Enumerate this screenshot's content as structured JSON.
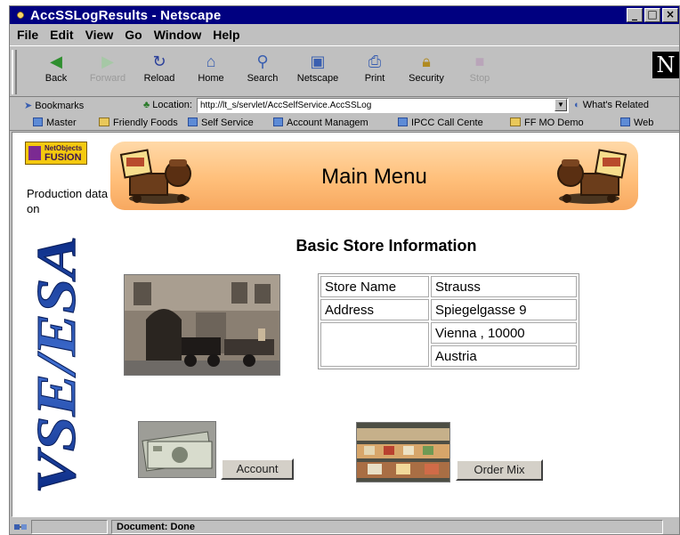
{
  "window": {
    "title": "AccSSLogResults - Netscape"
  },
  "menu": [
    "File",
    "Edit",
    "View",
    "Go",
    "Window",
    "Help"
  ],
  "toolbar": {
    "back": "Back",
    "forward": "Forward",
    "reload": "Reload",
    "home": "Home",
    "search": "Search",
    "netscape": "Netscape",
    "print": "Print",
    "security": "Security",
    "stop": "Stop"
  },
  "location": {
    "bookmarks_label": "Bookmarks",
    "label": "Location:",
    "url": "http://lt_s/servlet/AccSelfService.AccSSLog",
    "related": "What's Related"
  },
  "personal_toolbar": [
    "Master",
    "Friendly Foods",
    "Self Service",
    "Account Managem",
    "IPCC Call Cente",
    "FF MO Demo",
    "Web"
  ],
  "page": {
    "logo_top": "NetObjects",
    "logo_bottom": "FUSION",
    "production_note": "Production data on",
    "banner_title": "Main Menu",
    "side_brand": "VSE/ESA",
    "section_title": "Basic Store Information",
    "store": {
      "name_label": "Store Name",
      "name": "Strauss",
      "address_label": "Address",
      "street": "Spiegelgasse 9",
      "city_zip": "Vienna , 10000",
      "country": "Austria"
    },
    "account_button": "Account",
    "order_mix_button": "Order Mix"
  },
  "status": {
    "text": "Document: Done"
  }
}
